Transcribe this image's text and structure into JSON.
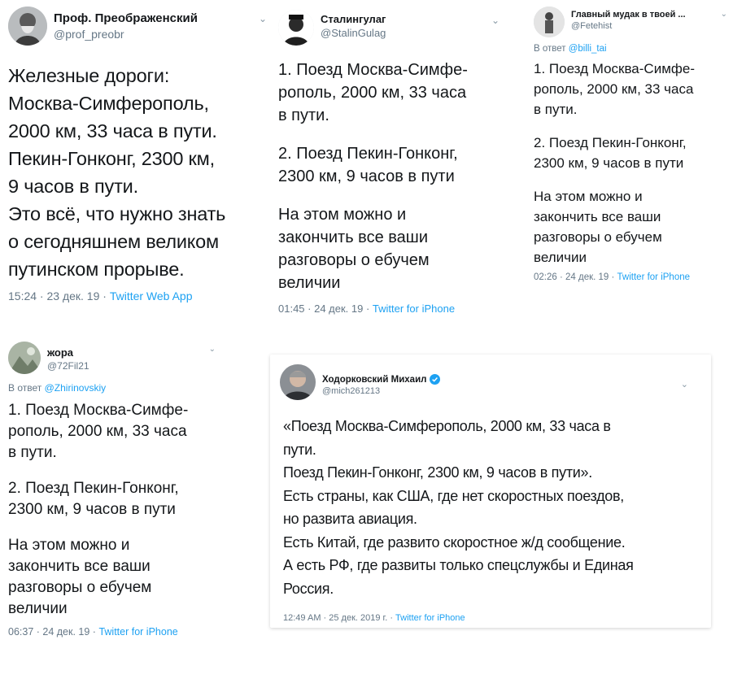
{
  "accent_color": "#1da1f2",
  "tweets": [
    {
      "author": "Проф. Преображенский",
      "handle": "@prof_preobr",
      "avatar_icon": "professor-portrait-avatar",
      "lines": [
        "Железные дороги:",
        "Москва-Симферополь,",
        "2000 км, 33 часа в пути.",
        "Пекин-Гонконг, 2300 км,",
        "9 часов в пути.",
        "Это всё, что нужно знать",
        "о сегодняшнем великом",
        "путинском прорыве."
      ],
      "time": "15:24 · 23 дек. 19 · ",
      "source": "Twitter Web App"
    },
    {
      "author": "Сталингулаг",
      "handle": "@StalinGulag",
      "avatar_icon": "stalin-portrait-avatar",
      "lines": [
        "1. Поезд Москва-Симфе-",
        "рополь, 2000 км, 33 часа",
        "в пути.",
        "",
        "2. Поезд Пекин-Гонконг,",
        "2300 км, 9 часов в пути",
        "",
        "На этом можно и",
        "закончить все ваши",
        "разговоры о ебучем",
        "величии"
      ],
      "time": "01:45 · 24 дек. 19 · ",
      "source": "Twitter for iPhone"
    },
    {
      "author": "Главный мудак в твоей ...",
      "handle": "@Fetehist",
      "avatar_icon": "figure-avatar",
      "reply_prefix": "В ответ ",
      "reply_to": "@billi_tai",
      "lines": [
        "1. Поезд Москва-Симфе-",
        "рополь, 2000 км, 33 часа",
        "в пути.",
        "",
        "2. Поезд Пекин-Гонконг,",
        "2300 км, 9 часов в пути",
        "",
        "На этом можно и",
        "закончить все ваши",
        "разговоры о ебучем",
        "величии"
      ],
      "time": "02:26 · 24 дек. 19 · ",
      "source": "Twitter for iPhone"
    },
    {
      "author": "жора",
      "handle": "@72Fil21",
      "avatar_icon": "photo-avatar",
      "reply_prefix": "В ответ ",
      "reply_to": "@Zhirinovskiy",
      "lines": [
        "1. Поезд Москва-Симфе-",
        "рополь, 2000 км, 33 часа",
        "в пути.",
        "",
        "2. Поезд Пекин-Гонконг,",
        "2300 км, 9 часов в пути",
        "",
        "На этом можно и",
        "закончить все ваши",
        "разговоры о ебучем",
        "величии"
      ],
      "time": "06:37 · 24 дек. 19 · ",
      "source": "Twitter for iPhone"
    },
    {
      "author": "Ходорковский Михаил",
      "handle": "@mich261213",
      "avatar_icon": "man-portrait-avatar",
      "verified": true,
      "lines": [
        "«Поезд Москва-Симферополь, 2000 км, 33 часа в",
        "пути.",
        "Поезд Пекин-Гонконг, 2300 км, 9 часов в пути».",
        "Есть страны, как США, где нет скоростных поездов,",
        "но развита авиация.",
        "Есть Китай, где развито скоростное ж/д сообщение.",
        "А есть РФ, где развиты только спецслужбы и Единая",
        "Россия."
      ],
      "time": "12:49 AM · 25 дек. 2019 г. · ",
      "source": "Twitter for iPhone"
    }
  ]
}
